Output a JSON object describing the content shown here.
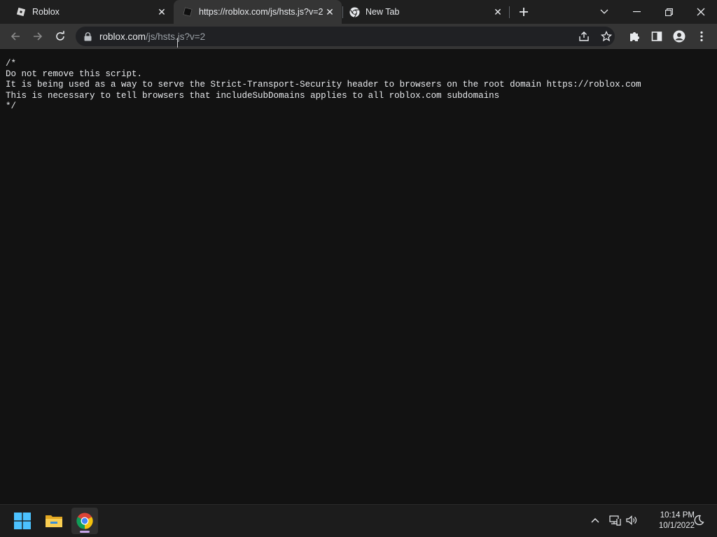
{
  "tabs": [
    {
      "title": "Roblox",
      "favicon": "roblox-logo-icon",
      "active": false
    },
    {
      "title": "https://roblox.com/js/hsts.js?v=2",
      "favicon": "roblox-logo-icon",
      "active": true
    },
    {
      "title": "New Tab",
      "favicon": "chrome-icon",
      "active": false
    }
  ],
  "toolbar": {
    "url_host": "roblox.com",
    "url_path": "/js/hsts.js?v=2"
  },
  "page": {
    "lines": [
      "/*",
      "Do not remove this script.",
      "It is being used as a way to serve the Strict-Transport-Security header to browsers on the root domain https://roblox.com",
      "This is necessary to tell browsers that includeSubDomains applies to all roblox.com subdomains",
      "*/"
    ]
  },
  "taskbar": {
    "time": "10:14 PM",
    "date": "10/1/2022",
    "apps": [
      "windows-start-icon",
      "file-explorer-icon",
      "chrome-icon"
    ],
    "tray_icons": [
      "chevron-up-icon",
      "network-icon",
      "volume-icon",
      "night-light-icon"
    ]
  },
  "colors": {
    "page_background": "#121212",
    "tab_strip": "#1f1f1f",
    "toolbar": "#353535",
    "omnibox": "#202124",
    "taskbar": "#1c1c1c"
  }
}
